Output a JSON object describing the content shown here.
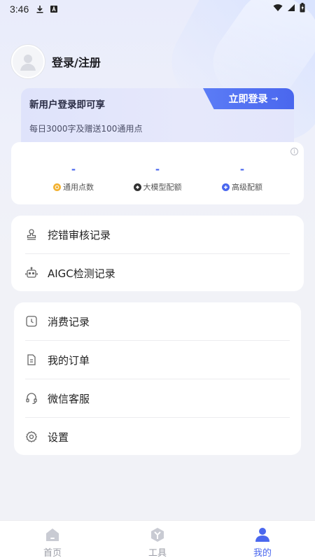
{
  "status_bar": {
    "time": "3:46",
    "icons": [
      "download-icon",
      "app-notification-icon",
      "wifi-icon",
      "signal-icon",
      "battery-charging-icon"
    ]
  },
  "profile": {
    "login_register": "登录/注册"
  },
  "banner": {
    "title": "新用户登录即可享",
    "subtitle": "每日3000字及赠送100通用点",
    "login_button": "立即登录",
    "login_arrow": "→"
  },
  "quota": {
    "items": [
      {
        "value": "-",
        "label": "通用点数",
        "icon": "coin-icon",
        "color": "#f2b233"
      },
      {
        "value": "-",
        "label": "大模型配额",
        "icon": "model-icon",
        "color": "#333333"
      },
      {
        "value": "-",
        "label": "高级配额",
        "icon": "plus-icon",
        "color": "#4a67ee"
      }
    ]
  },
  "menu_group_1": [
    {
      "label": "挖错审核记录",
      "icon": "stamp-icon"
    },
    {
      "label": "AIGC检测记录",
      "icon": "robot-icon"
    }
  ],
  "menu_group_2": [
    {
      "label": "消费记录",
      "icon": "clock-icon"
    },
    {
      "label": "我的订单",
      "icon": "order-document-icon"
    },
    {
      "label": "微信客服",
      "icon": "headset-icon"
    },
    {
      "label": "设置",
      "icon": "gear-icon"
    }
  ],
  "bottom_nav": {
    "items": [
      {
        "label": "首页",
        "icon": "home-icon",
        "active": false
      },
      {
        "label": "工具",
        "icon": "tools-icon",
        "active": false
      },
      {
        "label": "我的",
        "icon": "user-icon",
        "active": true
      }
    ],
    "active_color": "#4a67ee",
    "inactive_color": "#9a9ca6"
  }
}
